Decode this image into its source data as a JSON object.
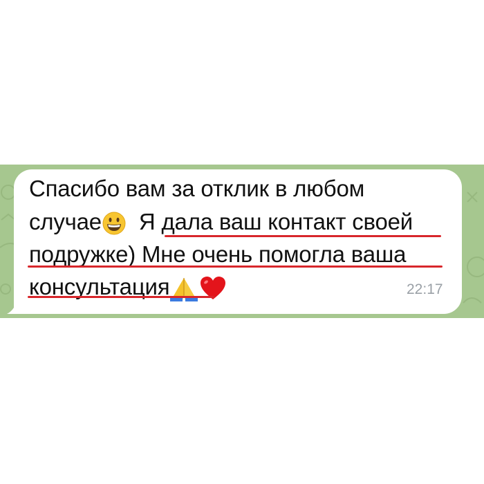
{
  "message": {
    "line1": "Спасибо вам за отклик в любом",
    "line2a": "случае",
    "line2b": "Я дала ваш контакт своей",
    "line3": "подружке) Мне очень помогла ваша",
    "line4": "консультация",
    "time": "22:17",
    "emojis": [
      "grinning-face",
      "folded-hands",
      "red-heart"
    ]
  },
  "colors": {
    "chat_background": "#a6c78f",
    "bubble": "#ffffff",
    "underline": "#d8262b",
    "time": "#9aa0a6"
  }
}
